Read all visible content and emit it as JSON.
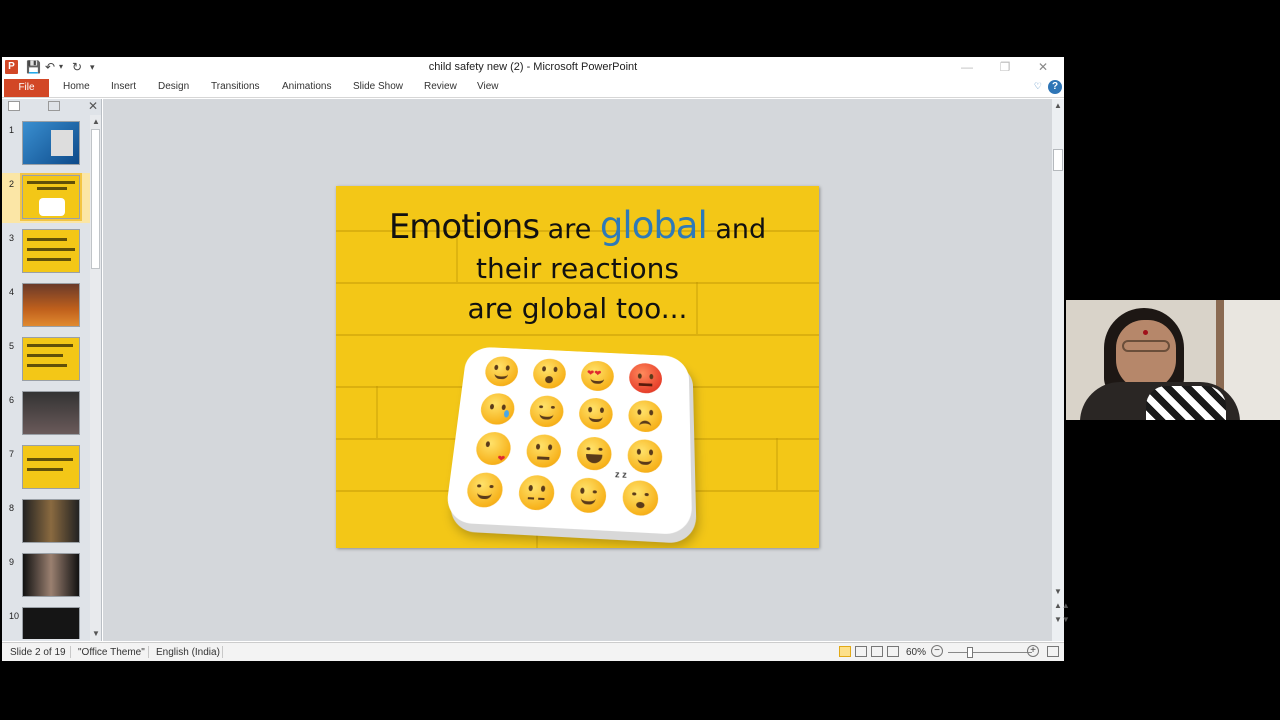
{
  "window": {
    "title": "child safety new (2)  -  Microsoft PowerPoint",
    "app_icon": "P",
    "quick_access": [
      "save-icon",
      "undo-icon",
      "redo-icon",
      "customize-icon"
    ]
  },
  "ribbon": {
    "file_label": "File",
    "tabs": [
      "Home",
      "Insert",
      "Design",
      "Transitions",
      "Animations",
      "Slide Show",
      "Review",
      "View"
    ],
    "help_label": "?"
  },
  "slide_pane": {
    "selected": 2,
    "numbers": [
      "1",
      "2",
      "3",
      "4",
      "5",
      "6",
      "7",
      "8",
      "9",
      "10"
    ]
  },
  "slide": {
    "line1_word1": "Emotions",
    "line1_word2": " are ",
    "line1_word3": "global",
    "line1_word4": " and",
    "line2": "their reactions",
    "line3": "are global too...",
    "accent_color": "#2e7ab8",
    "background_color": "#f3c717"
  },
  "status_bar": {
    "slide_info": "Slide 2 of 19",
    "theme": "\"Office Theme\"",
    "language": "English (India)",
    "zoom": "60%",
    "zoom_out": "−",
    "zoom_in": "+"
  }
}
